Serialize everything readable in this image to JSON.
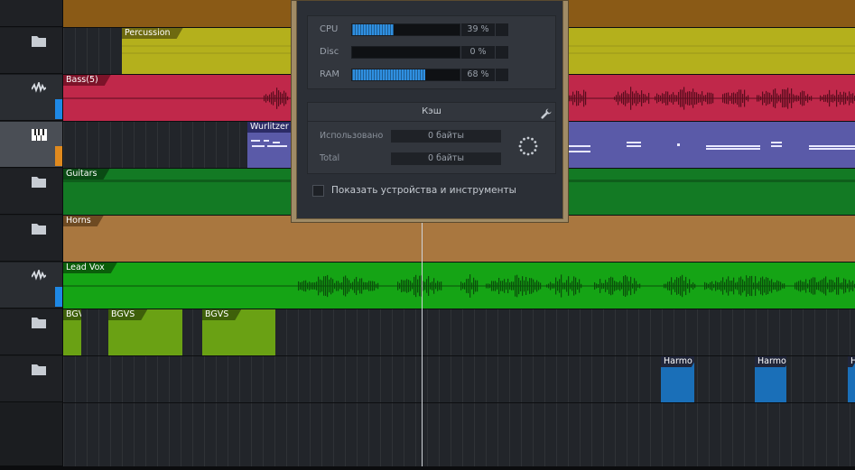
{
  "tracks": [
    {
      "icon": "folder-icon",
      "accent": ""
    },
    {
      "icon": "folder-icon",
      "accent": ""
    },
    {
      "icon": "waveform-icon",
      "accent": "#1e88e5"
    },
    {
      "icon": "piano-icon",
      "accent": "#e08a1e"
    },
    {
      "icon": "folder-icon",
      "accent": ""
    },
    {
      "icon": "folder-icon",
      "accent": ""
    },
    {
      "icon": "waveform-icon",
      "accent": "#1e88e5"
    },
    {
      "icon": "folder-icon",
      "accent": ""
    },
    {
      "icon": "folder-icon",
      "accent": ""
    }
  ],
  "events": {
    "percussion": "Percussion",
    "bass": "Bass(5)",
    "wurlitzer": "Wurlitzer",
    "guitars": "Guitars",
    "horns": "Horns",
    "lead_vox": "Lead Vox",
    "bgv_1": "BGV",
    "bgvs_2": "BGVS",
    "bgvs_3": "BGVS",
    "harmony_1": "Harmo",
    "harmony_2": "Harmo",
    "harmony_3": "H"
  },
  "colors": {
    "orange_folder": "#8a5a16",
    "percussion": "#b4b01c",
    "bass": "#c0284a",
    "wurlitzer": "#5a5aa8",
    "guitars": "#137a24",
    "horns": "#a9773f",
    "lead_vox": "#15a415",
    "bgvs": "#6aa114",
    "harmony": "#1a6fb8"
  },
  "performance": {
    "cpu_label": "CPU",
    "cpu_value": "39 %",
    "cpu_level": 0.39,
    "disc_label": "Disc",
    "disc_value": "0 %",
    "disc_level": 0.0,
    "ram_label": "RAM",
    "ram_value": "68 %",
    "ram_level": 0.68,
    "cache_title": "Кэш",
    "used_label": "Использовано",
    "used_value": "0 байты",
    "total_label": "Total",
    "total_value": "0 байты",
    "show_devices_label": "Показать устройства и инструменты"
  }
}
